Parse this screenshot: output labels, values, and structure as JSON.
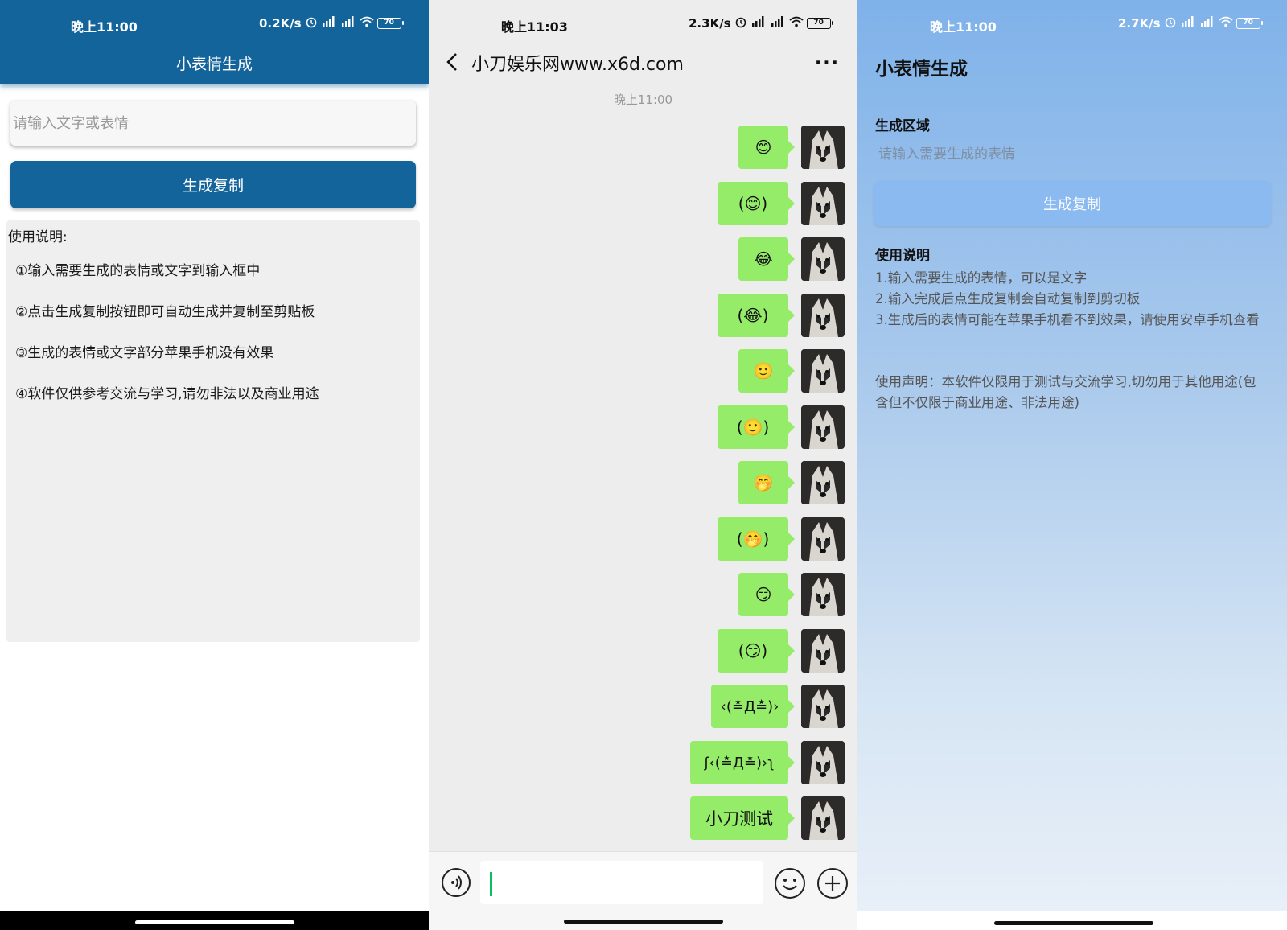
{
  "panel1": {
    "status": {
      "time": "晚上11:00",
      "speed": "0.2K/s",
      "battery": "70"
    },
    "app_title": "小表情生成",
    "input_placeholder": "请输入文字或表情",
    "button_label": "生成复制",
    "notes_title": "使用说明:",
    "notes": [
      "①输入需要生成的表情或文字到输入框中",
      "②点击生成复制按钮即可自动生成并复制至剪贴板",
      "③生成的表情或文字部分苹果手机没有效果",
      "④软件仅供参考交流与学习,请勿非法以及商业用途"
    ],
    "colors": {
      "primary": "#14649c"
    }
  },
  "panel2": {
    "status": {
      "time": "晚上11:03",
      "speed": "2.3K/s",
      "battery": "70"
    },
    "chat_title": "小刀娱乐网www.x6d.com",
    "more_label": "···",
    "timestamp": "晚上11:00",
    "messages": [
      {
        "text": "😊",
        "kind": "emoji"
      },
      {
        "text": "(😊)",
        "kind": "emoji-hands"
      },
      {
        "text": "😂",
        "kind": "emoji"
      },
      {
        "text": "(😂)",
        "kind": "emoji-hands"
      },
      {
        "text": "🙂",
        "kind": "emoji"
      },
      {
        "text": "(🙂)",
        "kind": "emoji-hands"
      },
      {
        "text": "🤭",
        "kind": "emoji"
      },
      {
        "text": "(🤭)",
        "kind": "emoji-hands"
      },
      {
        "text": "😏",
        "kind": "emoji"
      },
      {
        "text": "(😏)",
        "kind": "emoji-hands"
      },
      {
        "text": "‹(≛Д≛)›",
        "kind": "kaomoji"
      },
      {
        "text": "ʃ‹(≛Д≛)›ʅ",
        "kind": "kaomoji-hands"
      },
      {
        "text": "小刀测试",
        "kind": "text"
      }
    ],
    "colors": {
      "bubble": "#95ec69",
      "background": "#ededed",
      "cursor": "#07c160"
    }
  },
  "panel3": {
    "status": {
      "time": "晚上11:00",
      "speed": "2.7K/s",
      "battery": "70"
    },
    "app_title": "小表情生成",
    "section_label": "生成区域",
    "input_placeholder": "请输入需要生成的表情",
    "button_label": "生成复制",
    "notes_title": "使用说明",
    "notes": [
      "1.输入需要生成的表情，可以是文字",
      "2.输入完成后点生成复制会自动复制到剪切板",
      "3.生成后的表情可能在苹果手机看不到效果，请使用安卓手机查看"
    ],
    "disclaimer": "使用声明：本软件仅限用于测试与交流学习,切勿用于其他用途(包含但不仅限于商业用途、非法用途)",
    "colors": {
      "button": "#8bbaf0"
    }
  }
}
